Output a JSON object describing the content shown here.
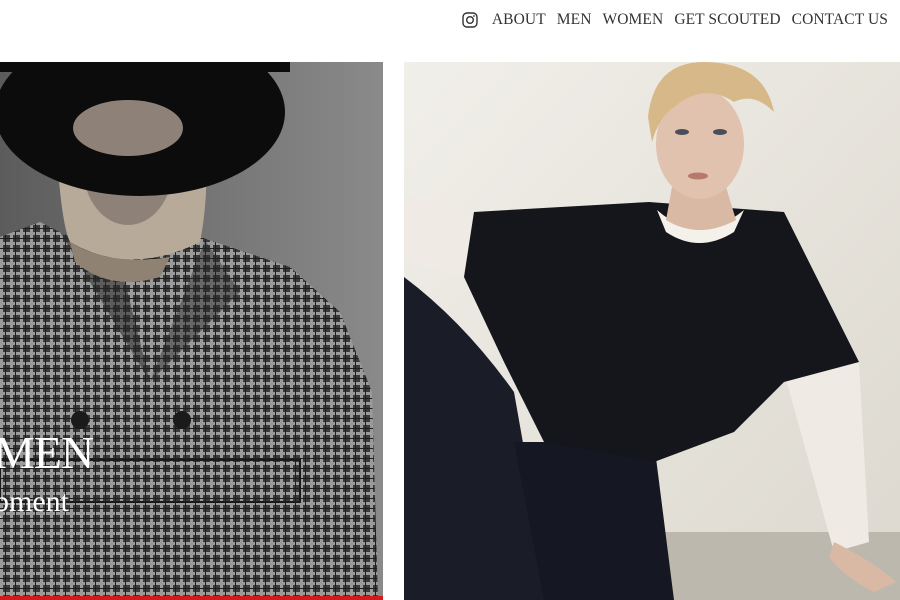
{
  "nav": {
    "instagram_icon": "instagram-icon",
    "items": [
      {
        "label": "ABOUT"
      },
      {
        "label": "MEN"
      },
      {
        "label": "WOMEN"
      },
      {
        "label": "GET SCOUTED"
      },
      {
        "label": "CONTACT US"
      }
    ]
  },
  "tiles": {
    "left": {
      "caption": "MEN",
      "subcaption": "pment",
      "accent_color": "#d21a1a"
    },
    "right": {}
  }
}
